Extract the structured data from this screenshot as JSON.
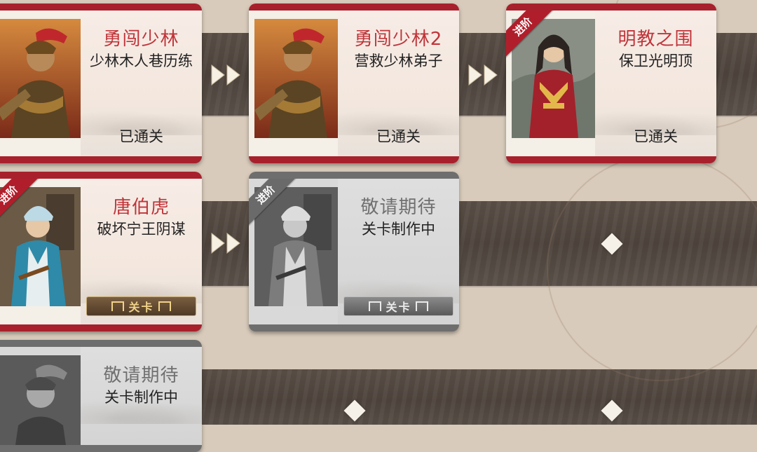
{
  "stages": [
    {
      "id": "s1",
      "title": "勇闯少林",
      "subtitle": "少林木人巷历练",
      "status": "已通关",
      "theme": "red",
      "advanced": false
    },
    {
      "id": "s2",
      "title": "勇闯少林2",
      "subtitle": "营救少林弟子",
      "status": "已通关",
      "theme": "red",
      "advanced": false
    },
    {
      "id": "s3",
      "title": "明教之围",
      "subtitle": "保卫光明顶",
      "status": "已通关",
      "theme": "red",
      "advanced": true
    },
    {
      "id": "s4",
      "title": "唐伯虎",
      "subtitle": "破坏宁王阴谋",
      "plaque": "关卡",
      "theme": "red",
      "advanced": true
    },
    {
      "id": "s5",
      "title": "敬请期待",
      "subtitle": "关卡制作中",
      "plaque": "关卡",
      "theme": "grey",
      "advanced": true
    },
    {
      "id": "s6",
      "title": "敬请期待",
      "subtitle": "关卡制作中",
      "theme": "grey",
      "advanced": false
    }
  ],
  "ribbon_label": "进阶",
  "colors": {
    "accent_red": "#a8202c",
    "title_red": "#c0343a",
    "locked_grey": "#6e6e6e",
    "band": "#4e443d"
  },
  "icons": {
    "next": "double-chevron-right-icon",
    "empty_slot": "diamond-icon"
  }
}
